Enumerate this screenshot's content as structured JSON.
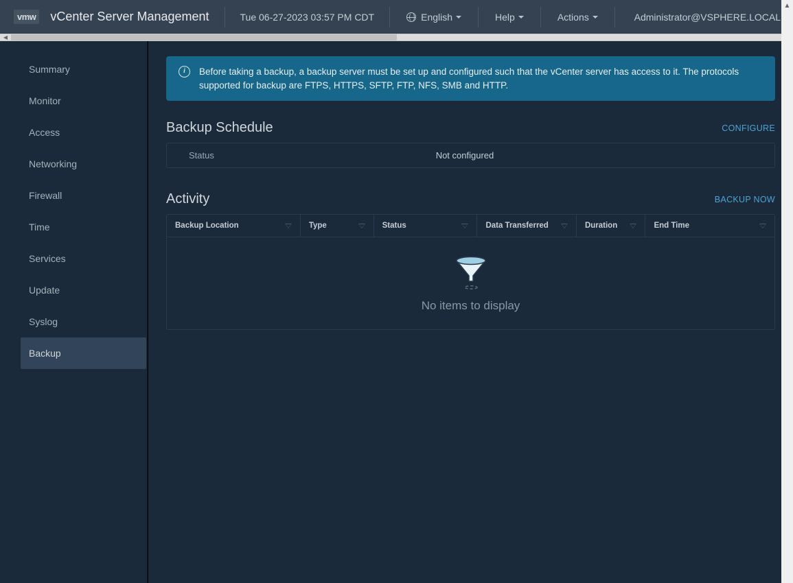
{
  "header": {
    "logo": "vmw",
    "title": "vCenter Server Management",
    "datetime": "Tue 06-27-2023 03:57 PM CDT",
    "language": "English",
    "help": "Help",
    "actions": "Actions",
    "user": "Administrator@VSPHERE.LOCAL"
  },
  "sidebar": {
    "items": [
      {
        "label": "Summary"
      },
      {
        "label": "Monitor"
      },
      {
        "label": "Access"
      },
      {
        "label": "Networking"
      },
      {
        "label": "Firewall"
      },
      {
        "label": "Time"
      },
      {
        "label": "Services"
      },
      {
        "label": "Update"
      },
      {
        "label": "Syslog"
      },
      {
        "label": "Backup"
      }
    ]
  },
  "banner": {
    "text": "Before taking a backup, a backup server must be set up and configured such that the vCenter server has access to it. The protocols supported for backup are FTPS, HTTPS, SFTP, FTP, NFS, SMB and HTTP."
  },
  "schedule": {
    "title": "Backup Schedule",
    "action": "CONFIGURE",
    "status_label": "Status",
    "status_value": "Not configured"
  },
  "activity": {
    "title": "Activity",
    "action": "BACKUP NOW",
    "columns": [
      "Backup Location",
      "Type",
      "Status",
      "Data Transferred",
      "Duration",
      "End Time"
    ],
    "empty": "No items to display"
  }
}
